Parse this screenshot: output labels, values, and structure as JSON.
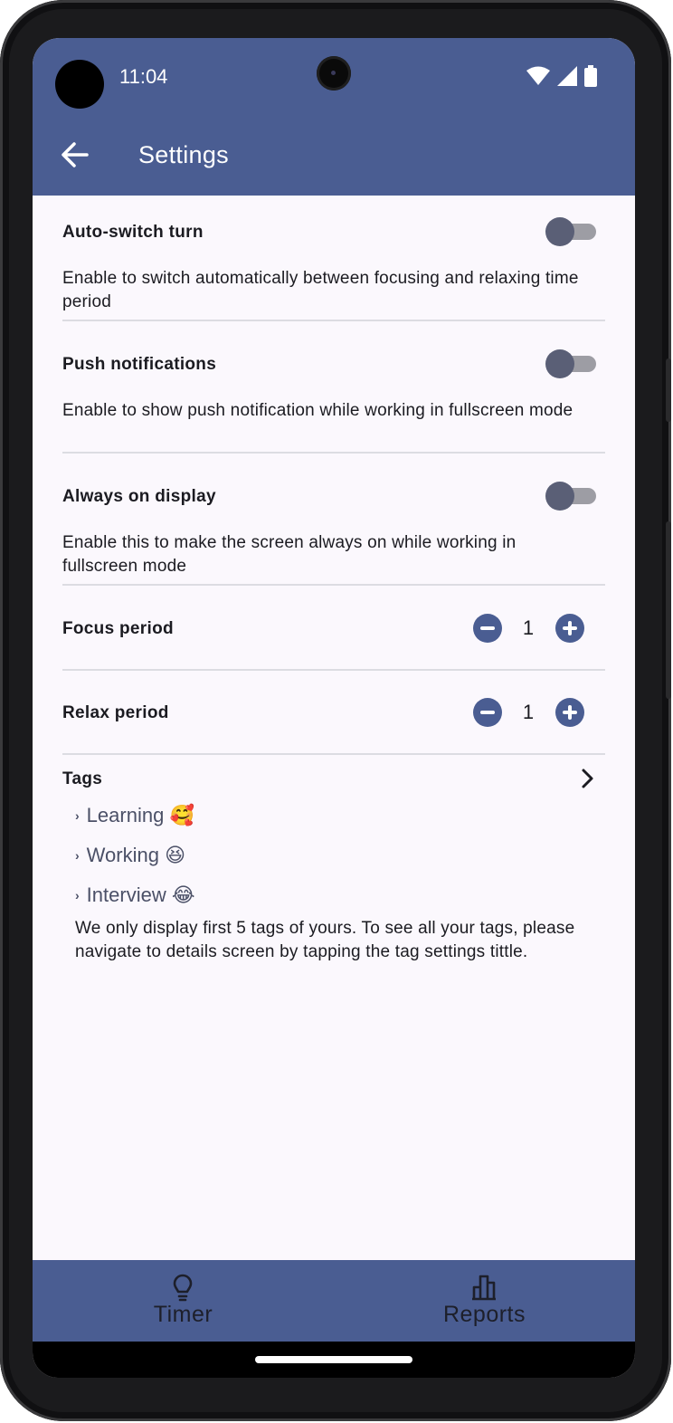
{
  "status_bar": {
    "time": "11:04"
  },
  "app_bar": {
    "title": "Settings",
    "back_icon": "arrow-left-icon"
  },
  "settings": {
    "auto_switch": {
      "title": "Auto-switch turn",
      "description": "Enable to switch automatically between focusing and relaxing time period",
      "enabled": false
    },
    "push_notifications": {
      "title": "Push notifications",
      "description": "Enable to show push notification while working in fullscreen mode",
      "enabled": false
    },
    "always_on_display": {
      "title": "Always on display",
      "description": "Enable this to make the screen always on while working in fullscreen mode",
      "enabled": false
    },
    "focus_period": {
      "title": "Focus period",
      "value": "1"
    },
    "relax_period": {
      "title": "Relax period",
      "value": "1"
    },
    "tags": {
      "title": "Tags",
      "items": [
        {
          "label": "Learning",
          "emoji": "🥰"
        },
        {
          "label": "Working",
          "emoji": "😆"
        },
        {
          "label": "Interview",
          "emoji": "😂"
        }
      ],
      "note": "We only display first 5 tags of yours. To see all your tags, please navigate to details screen by tapping the tag settings tittle."
    }
  },
  "bottom_nav": [
    {
      "label": "Timer",
      "icon": "lightbulb-icon"
    },
    {
      "label": "Reports",
      "icon": "bar-chart-icon"
    }
  ],
  "colors": {
    "primary": "#4a5d92",
    "background": "#fbf8fd",
    "toggle_thumb": "#5a5f76"
  }
}
